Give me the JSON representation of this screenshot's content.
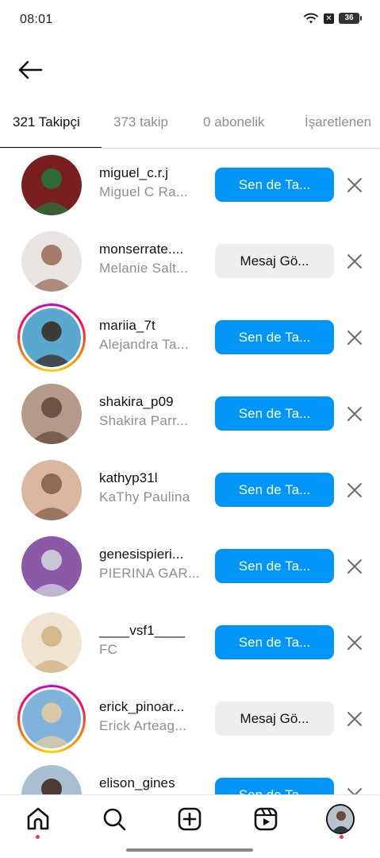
{
  "status_bar": {
    "time": "08:01",
    "battery": "36"
  },
  "tabs": [
    {
      "label": "321 Takipçi",
      "active": true
    },
    {
      "label": "373 takip",
      "active": false
    },
    {
      "label": "0 abonelik",
      "active": false
    },
    {
      "label": "İşaretlenen",
      "active": false
    }
  ],
  "followers": [
    {
      "username": "miguel_c.r.j",
      "fullname": "Miguel C Ra...",
      "action": "Sen de Ta...",
      "action_type": "follow",
      "story": false,
      "avatar_colors": [
        "#7a1f1f",
        "#2d6b3a"
      ]
    },
    {
      "username": "monserrate....",
      "fullname": "Melanie Salt...",
      "action": "Mesaj Gö...",
      "action_type": "message",
      "story": false,
      "avatar_colors": [
        "#e8e4e1",
        "#a47a6a"
      ]
    },
    {
      "username": "mariia_7t",
      "fullname": "Alejandra Ta...",
      "action": "Sen de Ta...",
      "action_type": "follow",
      "story": true,
      "avatar_colors": [
        "#5aa7cf",
        "#3d3a3a"
      ]
    },
    {
      "username": "shakira_p09",
      "fullname": "Shakira Parr...",
      "action": "Sen de Ta...",
      "action_type": "follow",
      "story": false,
      "avatar_colors": [
        "#b49a8a",
        "#6d5247"
      ]
    },
    {
      "username": "kathyp31l",
      "fullname": "KaThy Paulina",
      "action": "Sen de Ta...",
      "action_type": "follow",
      "story": false,
      "avatar_colors": [
        "#d9b6a0",
        "#8d6a57"
      ]
    },
    {
      "username": "genesispieri...",
      "fullname": "PIERINA GAR...",
      "action": "Sen de Ta...",
      "action_type": "follow",
      "story": false,
      "avatar_colors": [
        "#8a5aa8",
        "#c9c7d6"
      ]
    },
    {
      "username": "____vsf1____",
      "fullname": "FC",
      "action": "Sen de Ta...",
      "action_type": "follow",
      "story": false,
      "avatar_colors": [
        "#efe3d2",
        "#d6b98a"
      ]
    },
    {
      "username": "erick_pinoar...",
      "fullname": "Erick Arteag...",
      "action": "Mesaj Gö...",
      "action_type": "message",
      "story": true,
      "avatar_colors": [
        "#7fb3dc",
        "#d8c9a5"
      ]
    },
    {
      "username": "elison_gines",
      "fullname": "",
      "action": "Sen de Ta...",
      "action_type": "follow",
      "story": false,
      "avatar_colors": [
        "#a8bfd2",
        "#4b3a33"
      ]
    }
  ],
  "nav": {
    "items": [
      "home-icon",
      "search-icon",
      "create-icon",
      "reels-icon",
      "profile-avatar"
    ],
    "notification_color": "#ff3040"
  },
  "colors": {
    "primary": "#0095f6",
    "secondary_button": "#efefef",
    "muted_text": "#8e8e8e"
  }
}
